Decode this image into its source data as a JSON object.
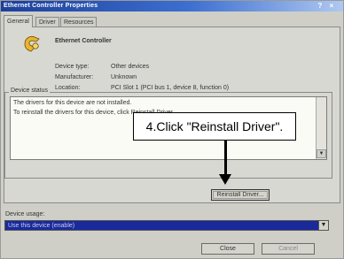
{
  "window": {
    "title": "Ethernet Controller Properties",
    "help_label": "?",
    "close_label": "×"
  },
  "tabs": [
    {
      "label": "General"
    },
    {
      "label": "Driver"
    },
    {
      "label": "Resources"
    }
  ],
  "device": {
    "name": "Ethernet Controller",
    "rows": [
      {
        "label": "Device type:",
        "value": "Other devices"
      },
      {
        "label": "Manufacturer:",
        "value": "Unknown"
      },
      {
        "label": "Location:",
        "value": "PCI Slot 1 (PCI bus 1, device 8, function 0)"
      }
    ]
  },
  "status": {
    "group_label": "Device status",
    "lines": [
      "The drivers for this device are not installed.",
      "To reinstall the drivers for this device, click Reinstall Driver."
    ]
  },
  "reinstall_button": "Reinstall Driver...",
  "callout": "4.Click \"Reinstall Driver\".",
  "usage": {
    "label": "Device usage:",
    "value": "Use this device (enable)"
  },
  "buttons": {
    "close": "Close",
    "cancel": "Cancel"
  }
}
